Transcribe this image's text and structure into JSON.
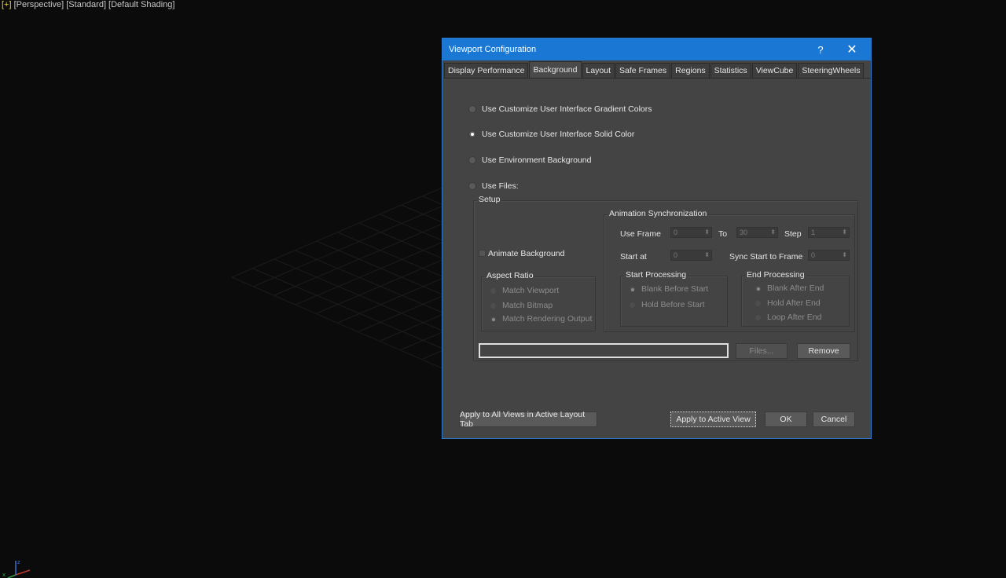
{
  "viewport": {
    "label_plus": "[+]",
    "label_rest": "[Perspective] [Standard] [Default Shading]"
  },
  "dialog": {
    "title": "Viewport Configuration",
    "help_glyph": "?",
    "close_glyph": "✕",
    "tabs": [
      {
        "label": "Display Performance",
        "active": false
      },
      {
        "label": "Background",
        "active": true
      },
      {
        "label": "Layout",
        "active": false
      },
      {
        "label": "Safe Frames",
        "active": false
      },
      {
        "label": "Regions",
        "active": false
      },
      {
        "label": "Statistics",
        "active": false
      },
      {
        "label": "ViewCube",
        "active": false
      },
      {
        "label": "SteeringWheels",
        "active": false
      }
    ],
    "options": {
      "gradient": "Use Customize User Interface Gradient Colors",
      "solid": "Use Customize User Interface Solid Color",
      "environment": "Use Environment Background",
      "files": "Use Files:",
      "selected": "solid"
    },
    "setup": {
      "title": "Setup",
      "animate_background": "Animate Background",
      "aspect_ratio": {
        "title": "Aspect Ratio",
        "match_viewport": "Match Viewport",
        "match_bitmap": "Match Bitmap",
        "match_rendering_output": "Match Rendering Output",
        "selected": "match_rendering_output"
      },
      "anim_sync": {
        "title": "Animation Synchronization",
        "use_frame_label": "Use Frame",
        "use_frame_value": "0",
        "to_label": "To",
        "to_value": "30",
        "step_label": "Step",
        "step_value": "1",
        "start_at_label": "Start at",
        "start_at_value": "0",
        "sync_start_label": "Sync Start to Frame",
        "sync_start_value": "0"
      },
      "start_processing": {
        "title": "Start Processing",
        "blank_before_start": "Blank Before Start",
        "hold_before_start": "Hold Before Start",
        "selected": "blank_before_start"
      },
      "end_processing": {
        "title": "End Processing",
        "blank_after_end": "Blank After End",
        "hold_after_end": "Hold After End",
        "loop_after_end": "Loop After End",
        "selected": "blank_after_end"
      },
      "file_path": "",
      "files_button": "Files...",
      "remove_button": "Remove"
    },
    "buttons": {
      "apply_all": "Apply to All Views in Active Layout Tab",
      "apply_active": "Apply to Active View",
      "ok": "OK",
      "cancel": "Cancel"
    }
  },
  "colors": {
    "title_bar": "#1a78d4",
    "dialog_bg": "#444444",
    "viewport_bg": "#0b0b0b"
  }
}
